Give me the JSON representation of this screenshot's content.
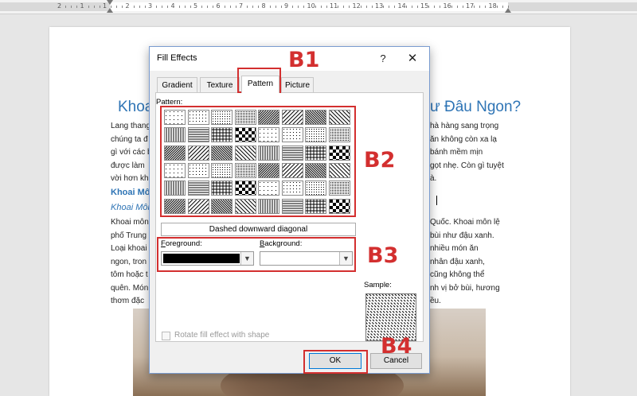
{
  "ruler": {
    "numbers": [
      "2",
      "1",
      "1",
      "2",
      "3",
      "4",
      "5",
      "6",
      "7",
      "8",
      "9",
      "10",
      "11",
      "12",
      "13",
      "14",
      "15",
      "16",
      "17",
      "18"
    ]
  },
  "document": {
    "heading_left": "Khoa",
    "heading_right": "ư Đâu Ngon?",
    "para1_left": [
      "Lang thang",
      "chúng ta đ",
      "gì với các b",
      "được làm",
      "vời hơn kh"
    ],
    "para1_right": [
      "hà hàng sang trọng",
      "ăn không còn xa lạ",
      "bánh mềm mịn",
      "gọt nhẹ. Còn gì tuyệt",
      "à."
    ],
    "subheading": "Khoai Mô",
    "subheading2": "Khoai Môn",
    "para2_left": [
      "Khoai môn",
      "phố Trung",
      "Loại khoai",
      "ngon, tron",
      "tôm hoặc t",
      "quên. Món",
      "thơm đặc"
    ],
    "para2_right": [
      "Quốc. Khoai môn lệ",
      "bùi như đậu xanh.",
      "nhiều món ăn",
      "nhân đậu xanh,",
      "cũng không thể",
      "nh vị bở bùi, hương",
      "ều."
    ]
  },
  "dialog": {
    "title": "Fill Effects",
    "help": "?",
    "close": "✕",
    "tabs": [
      "Gradient",
      "Texture",
      "Pattern",
      "Picture"
    ],
    "active_tab": "Pattern",
    "pattern_label": "Pattern:",
    "selected_pattern": "Dashed downward diagonal",
    "foreground_label_u": "F",
    "foreground_label_rest": "oreground:",
    "foreground_color": "#000000",
    "background_label_u": "B",
    "background_label_rest": "ackground:",
    "background_color": "#ffffff",
    "sample_label": "Sample:",
    "rotate_label": "Rotate fill effect with shape",
    "rotate_checked": false,
    "ok": "OK",
    "cancel": "Cancel"
  },
  "callouts": {
    "b1": "B1",
    "b2": "B2",
    "b3": "B3",
    "b4": "B4",
    "color": "#d32f2f"
  }
}
